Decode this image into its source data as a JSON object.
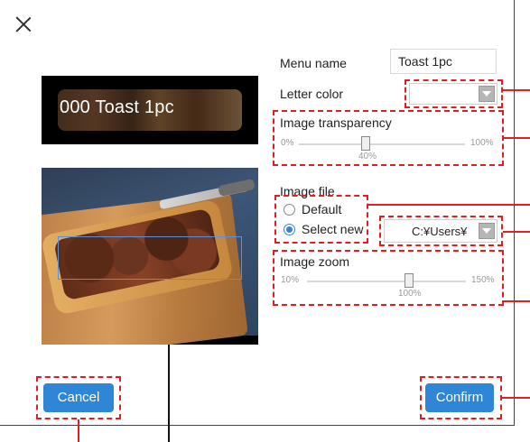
{
  "dialog": {
    "close_icon": "close-icon",
    "preview": {
      "banner_text": "000 Toast 1pc"
    },
    "menu_name": {
      "label": "Menu name",
      "value": "Toast 1pc"
    },
    "letter_color": {
      "label": "Letter color"
    },
    "image_transparency": {
      "label": "Image transparency",
      "min": "0%",
      "max": "100%",
      "value_label": "40%",
      "value": 40
    },
    "image_file": {
      "label": "Image file",
      "options": [
        "Default",
        "Select new"
      ],
      "selected": "Select new",
      "path": "C:¥Users¥"
    },
    "image_zoom": {
      "label": "Image zoom",
      "min": "10%",
      "max": "150%",
      "value_label": "100%",
      "value": 100
    },
    "buttons": {
      "cancel": "Cancel",
      "confirm": "Confirm"
    }
  },
  "colors": {
    "accent": "#2f86d6",
    "annotation": "#e02020"
  }
}
